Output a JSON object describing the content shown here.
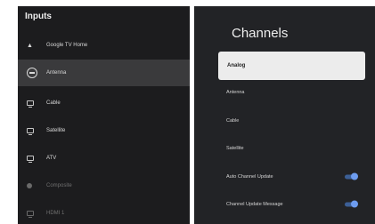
{
  "inputs": {
    "title": "Inputs",
    "items": [
      {
        "label": "Google TV Home",
        "icon": "home-icon",
        "state": "normal"
      },
      {
        "label": "Antenna",
        "icon": "antenna-icon",
        "state": "selected"
      },
      {
        "label": "Cable",
        "icon": "tv-icon",
        "state": "normal"
      },
      {
        "label": "Satellite",
        "icon": "tv-icon",
        "state": "normal"
      },
      {
        "label": "ATV",
        "icon": "tv-icon",
        "state": "normal"
      },
      {
        "label": "Composite",
        "icon": "composite-icon",
        "state": "disabled"
      },
      {
        "label": "HDMI 1",
        "icon": "hdmi-icon",
        "state": "disabled"
      }
    ]
  },
  "channels": {
    "title": "Channels",
    "items": [
      {
        "label": "Analog",
        "selected": true
      },
      {
        "label": "Antenna"
      },
      {
        "label": "Cable"
      },
      {
        "label": "Satellite"
      },
      {
        "label": "Auto Channel Update",
        "toggle": true
      },
      {
        "label": "Channel Update Message",
        "toggle": true
      }
    ]
  },
  "colors": {
    "panel_bg": "#1c1c1e",
    "selected_bg": "#3a3a3c",
    "highlight_bg": "#ececec",
    "toggle_on": "#6d9cf0"
  }
}
